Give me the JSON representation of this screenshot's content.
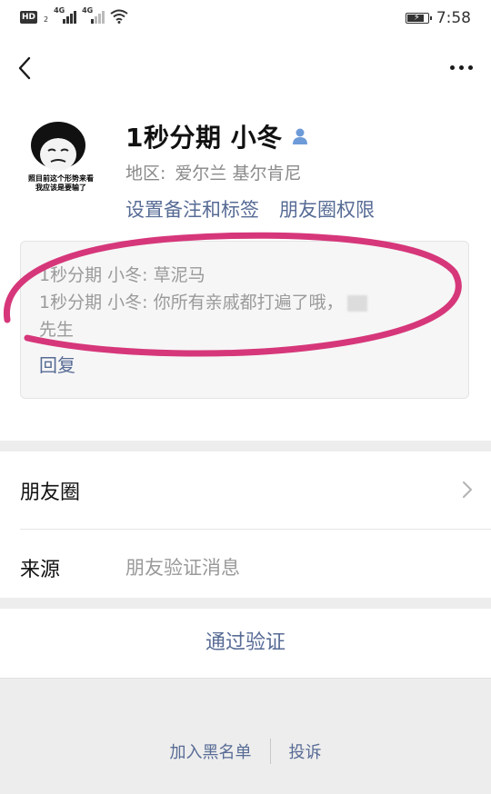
{
  "status_bar": {
    "hd": "HD",
    "hd_sub": "2",
    "network1": "4G",
    "network2": "4G",
    "time": "7:58",
    "battery_level": 0.9,
    "icons": [
      "hd-icon",
      "signal-icon",
      "wifi-icon",
      "battery-charging-icon"
    ]
  },
  "nav": {
    "back_icon": "back-chevron-icon",
    "more_icon": "more-dots-icon"
  },
  "profile": {
    "avatar_caption": "照目前这个形势来看\n我应该是要输了",
    "name": "1秒分期 小冬",
    "region_label": "地区:",
    "region_value": "爱尔兰  基尔肯尼",
    "set_remark": "设置备注和标签",
    "moments_permission": "朋友圈权限"
  },
  "messages": {
    "line1": "1秒分期 小冬: 草泥马",
    "line2": "1秒分期 小冬: 你所有亲戚都打遍了哦，",
    "line2_end": "先生",
    "reply": "回复"
  },
  "list": {
    "moments": "朋友圈",
    "source_label": "来源",
    "source_value": "朋友验证消息"
  },
  "actions": {
    "approve": "通过验证",
    "blacklist": "加入黑名单",
    "complain": "投诉"
  },
  "colors": {
    "link": "#576b95",
    "annotation": "#d6377a",
    "separator": "#ededed"
  }
}
